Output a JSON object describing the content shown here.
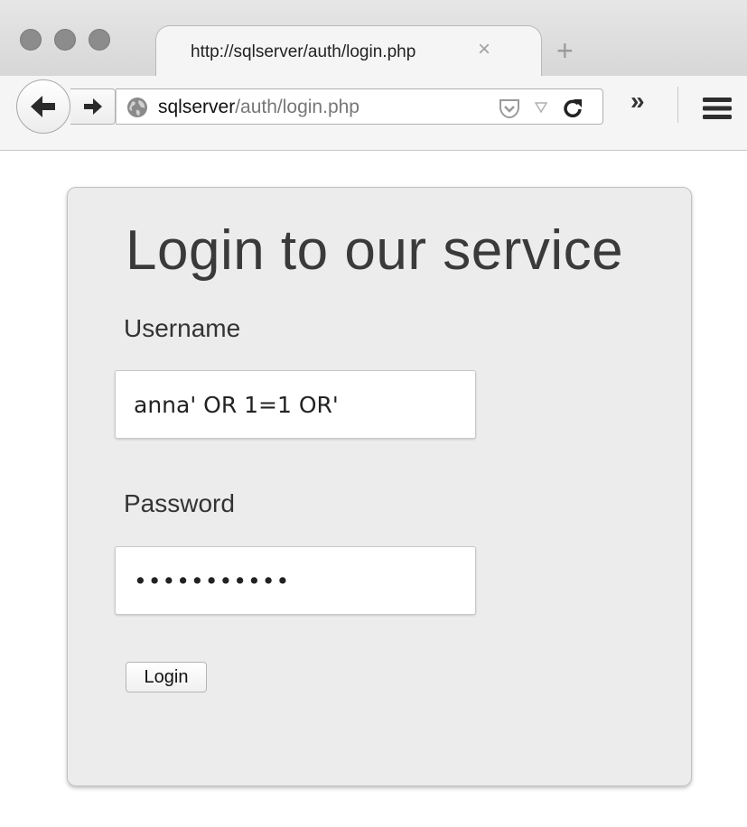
{
  "browser": {
    "tab": {
      "title": "http://sqlserver/auth/login.php",
      "close_glyph": "×"
    },
    "new_tab_glyph": "+",
    "url": {
      "host": "sqlserver",
      "path": "/auth/login.php"
    },
    "overflow_glyph": "»",
    "icons": {
      "back": "back-arrow-icon",
      "forward": "forward-arrow-icon",
      "site": "globe-icon",
      "pocket": "pocket-icon",
      "dropmarker": "dropdown-triangle-icon",
      "reload": "reload-icon",
      "menu": "hamburger-menu-icon"
    }
  },
  "page": {
    "title": "Login to our service",
    "username": {
      "label": "Username",
      "value": "anna' OR 1=1 OR'"
    },
    "password": {
      "label": "Password",
      "masked_value": "•••••••••••"
    },
    "login_button": "Login"
  }
}
